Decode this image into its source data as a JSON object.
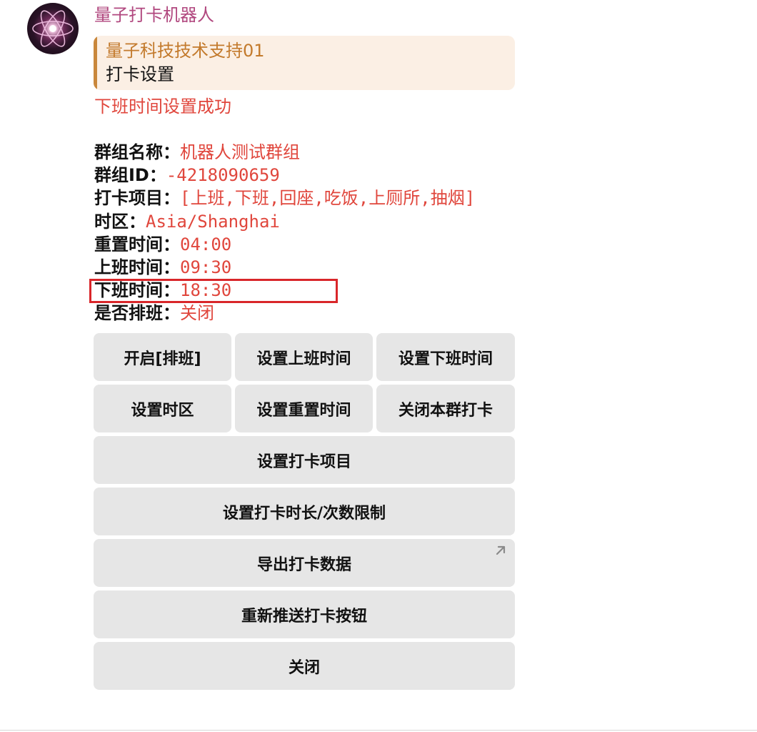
{
  "message": {
    "sender": "量子打卡机器人",
    "reply": {
      "title": "量子科技技术支持01",
      "text": "打卡设置"
    },
    "status": "下班时间设置成功",
    "info": [
      {
        "label": "群组名称：",
        "value": "机器人测试群组"
      },
      {
        "label": "群组ID：",
        "value": "-4218090659"
      },
      {
        "label": "打卡项目：",
        "value": "[上班,下班,回座,吃饭,上厕所,抽烟]"
      },
      {
        "label": "时区：",
        "value": "Asia/Shanghai"
      },
      {
        "label": "重置时间：",
        "value": "04:00"
      },
      {
        "label": "上班时间：",
        "value": "09:30"
      },
      {
        "label": "下班时间：",
        "value": "18:30"
      },
      {
        "label": "是否排班：",
        "value": "关闭"
      }
    ]
  },
  "buttons": {
    "row1": [
      "开启[排班]",
      "设置上班时间",
      "设置下班时间"
    ],
    "row2": [
      "设置时区",
      "设置重置时间",
      "关闭本群打卡"
    ],
    "set_items": "设置打卡项目",
    "set_limits": "设置打卡时长/次数限制",
    "export": "导出打卡数据",
    "repush": "重新推送打卡按钮",
    "close": "关闭"
  },
  "icons": {
    "avatar": "atom-avatar",
    "export_link": "external-link-arrow-icon"
  },
  "colors": {
    "sender": "#b1487f",
    "reply_bar": "#c9873b",
    "reply_bg": "#fbefe4",
    "value_red": "#e0463c",
    "button_bg": "#e6e6e6",
    "highlight_border": "#d9262a"
  }
}
